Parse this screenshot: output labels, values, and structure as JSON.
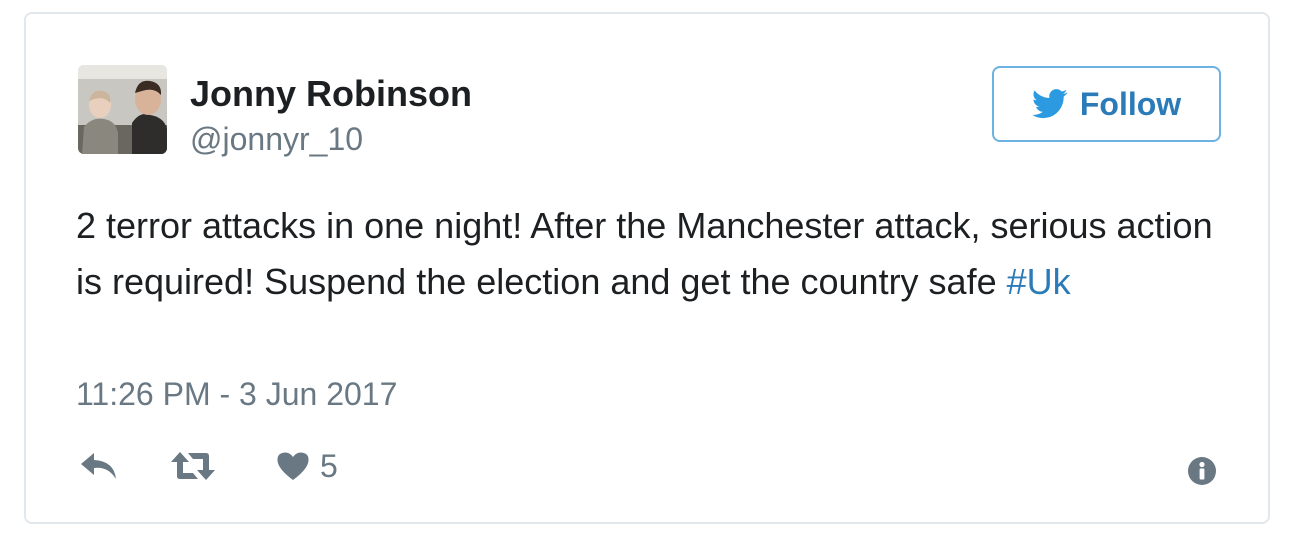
{
  "author": {
    "name": "Jonny Robinson",
    "handle": "@jonnyr_10",
    "avatar_icon": "user-photo"
  },
  "follow_button": {
    "label": "Follow",
    "icon": "twitter-bird-icon",
    "color": "#2b7bb9",
    "border_color": "#6cb2e3"
  },
  "tweet": {
    "text": "2 terror attacks in one night! After the Manchester attack, serious action is required! Suspend the election and get the country safe ",
    "hashtag": "#Uk",
    "timestamp": "11:26 PM - 3 Jun 2017"
  },
  "actions": {
    "reply_icon": "reply-icon",
    "retweet_icon": "retweet-icon",
    "like_icon": "heart-icon",
    "like_count": "5",
    "info_icon": "info-icon"
  },
  "colors": {
    "text": "#1c2022",
    "muted": "#697882",
    "link": "#2b7bb9",
    "border": "#e1e8ed"
  }
}
